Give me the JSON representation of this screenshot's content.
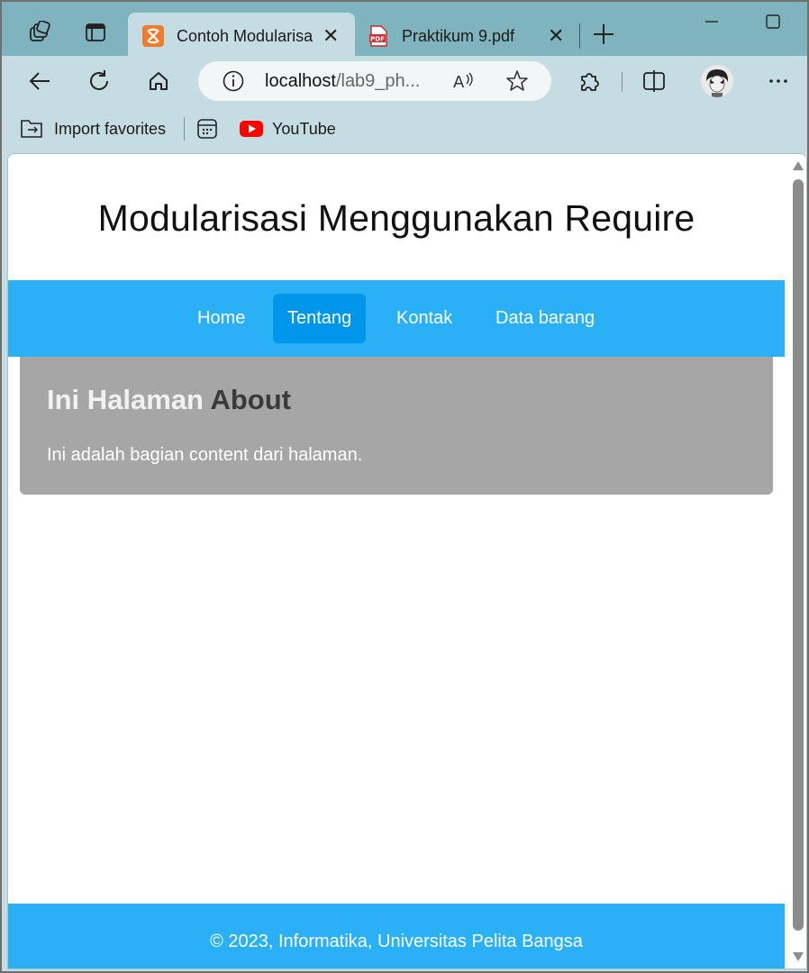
{
  "browser": {
    "tabs": [
      {
        "title": "Contoh Modularisasi",
        "active": true,
        "favicon": "xampp-icon"
      },
      {
        "title": "Praktikum 9.pdf",
        "active": false,
        "favicon": "pdf-icon"
      }
    ],
    "address": {
      "host": "localhost",
      "path": "/lab9_ph..."
    },
    "favorites": {
      "import_label": "Import favorites",
      "youtube_label": "YouTube"
    },
    "colors": {
      "frame": "#7fb4bf",
      "toolbar": "#c5dde2"
    }
  },
  "page": {
    "header_title": "Modularisasi Menggunakan Require",
    "nav": [
      {
        "label": "Home",
        "active": false
      },
      {
        "label": "Tentang",
        "active": true
      },
      {
        "label": "Kontak",
        "active": false
      },
      {
        "label": "Data barang",
        "active": false
      }
    ],
    "content": {
      "heading_main": "Ini Halaman ",
      "heading_accent": "About",
      "text": "Ini adalah bagian content dari halaman."
    },
    "footer_text": "© 2023, Informatika, Universitas Pelita Bangsa",
    "colors": {
      "nav": "#2ab0f5",
      "nav_active": "#0096ea",
      "content_bg": "#a6a6a6",
      "footer": "#2ab0f5"
    }
  }
}
